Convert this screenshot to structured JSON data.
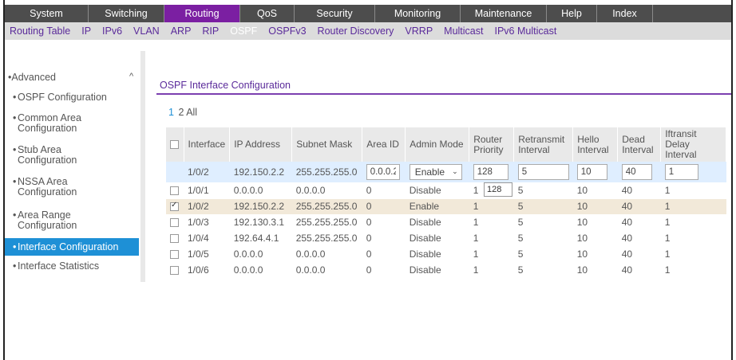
{
  "topnav": [
    {
      "label": "System",
      "active": false,
      "width": 105
    },
    {
      "label": "Switching",
      "active": false,
      "width": 95
    },
    {
      "label": "Routing",
      "active": true,
      "width": 95
    },
    {
      "label": "QoS",
      "active": false,
      "width": 68
    },
    {
      "label": "Security",
      "active": false,
      "width": 101
    },
    {
      "label": "Monitoring",
      "active": false,
      "width": 107
    },
    {
      "label": "Maintenance",
      "active": false,
      "width": 108
    },
    {
      "label": "Help",
      "active": false,
      "width": 63
    },
    {
      "label": "Index",
      "active": false,
      "width": 70
    }
  ],
  "subnav": [
    {
      "label": "Routing Table",
      "active": false
    },
    {
      "label": "IP",
      "active": false
    },
    {
      "label": "IPv6",
      "active": false
    },
    {
      "label": "VLAN",
      "active": false
    },
    {
      "label": "ARP",
      "active": false
    },
    {
      "label": "RIP",
      "active": false
    },
    {
      "label": "OSPF",
      "active": true
    },
    {
      "label": "OSPFv3",
      "active": false
    },
    {
      "label": "Router Discovery",
      "active": false
    },
    {
      "label": "VRRP",
      "active": false
    },
    {
      "label": "Multicast",
      "active": false
    },
    {
      "label": "IPv6 Multicast",
      "active": false
    }
  ],
  "sidebar": {
    "heading": "Advanced",
    "items": [
      {
        "label": "OSPF Configuration",
        "active": false
      },
      {
        "label": "Common Area Configuration",
        "active": false
      },
      {
        "label": "Stub Area Configuration",
        "active": false
      },
      {
        "label": "NSSA Area Configuration",
        "active": false
      },
      {
        "label": "Area Range Configuration",
        "active": false
      },
      {
        "label": "Interface Configuration",
        "active": true
      },
      {
        "label": "Interface Statistics",
        "active": false
      }
    ]
  },
  "content": {
    "title": "OSPF Interface Configuration",
    "pages": [
      "1",
      "2"
    ],
    "all_label": "All"
  },
  "table": {
    "headers": [
      "",
      "Interface",
      "IP Address",
      "Subnet Mask",
      "Area ID",
      "Admin Mode",
      "Router Priority",
      "Retransmit Interval",
      "Hello Interval",
      "Dead Interval",
      "Iftransit Delay Interval"
    ],
    "edit_row": {
      "interface": "1/0/2",
      "ip": "192.150.2.2",
      "mask": "255.255.255.0",
      "area_id": "0.0.0.2",
      "admin_mode": "Enable",
      "router_priority": "128",
      "retransmit": "5",
      "hello": "10",
      "dead": "40",
      "transit": "1"
    },
    "dropdown_value": "128",
    "rows": [
      {
        "checked": false,
        "cells": [
          "1/0/1",
          "0.0.0.0",
          "0.0.0.0",
          "0",
          "Disable",
          "1",
          "5",
          "10",
          "40",
          "1"
        ]
      },
      {
        "checked": true,
        "cells": [
          "1/0/2",
          "192.150.2.2",
          "255.255.255.0",
          "0",
          "Enable",
          "1",
          "5",
          "10",
          "40",
          "1"
        ]
      },
      {
        "checked": false,
        "cells": [
          "1/0/3",
          "192.130.3.1",
          "255.255.255.0",
          "0",
          "Disable",
          "1",
          "5",
          "10",
          "40",
          "1"
        ]
      },
      {
        "checked": false,
        "cells": [
          "1/0/4",
          "192.64.4.1",
          "255.255.255.0",
          "0",
          "Disable",
          "1",
          "5",
          "10",
          "40",
          "1"
        ]
      },
      {
        "checked": false,
        "cells": [
          "1/0/5",
          "0.0.0.0",
          "0.0.0.0",
          "0",
          "Disable",
          "1",
          "5",
          "10",
          "40",
          "1"
        ]
      },
      {
        "checked": false,
        "cells": [
          "1/0/6",
          "0.0.0.0",
          "0.0.0.0",
          "0",
          "Disable",
          "1",
          "5",
          "10",
          "40",
          "1"
        ]
      }
    ]
  },
  "colors": {
    "accent": "#7b1fa2",
    "nav_bg": "#4d4d4d",
    "sidebar_active": "#1e90d6"
  }
}
